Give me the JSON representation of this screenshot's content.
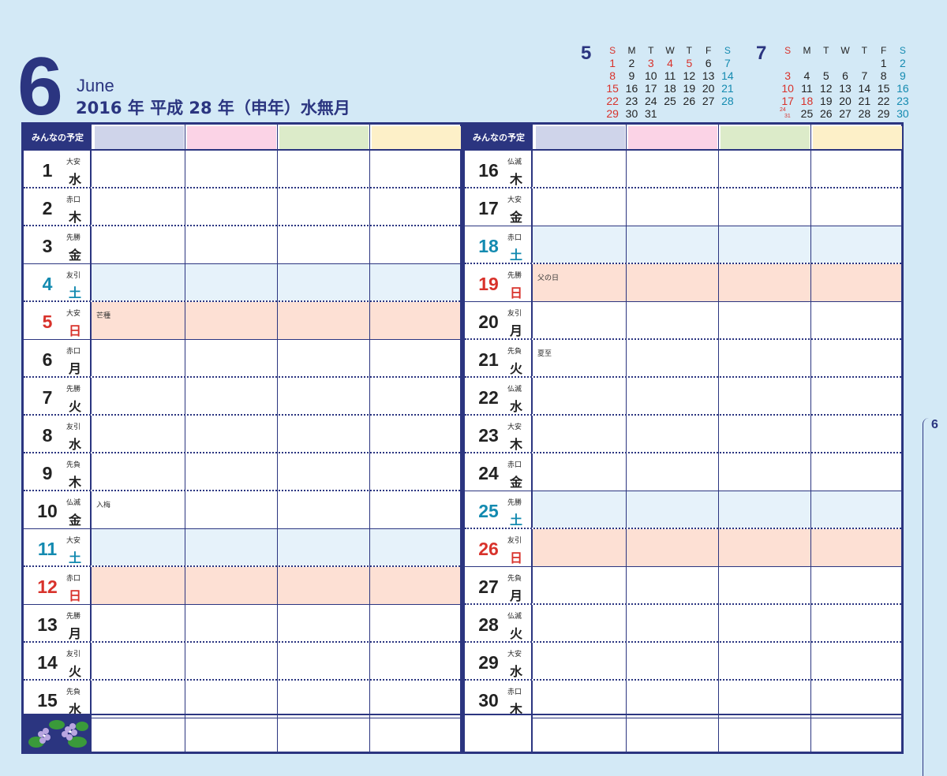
{
  "header": {
    "month_number": "6",
    "month_en": "June",
    "year_line": "2016 年  平成 28 年（申年）水無月"
  },
  "mini_calendars": [
    {
      "month": "5",
      "weekdays": [
        "S",
        "M",
        "T",
        "W",
        "T",
        "F",
        "S"
      ],
      "rows": [
        [
          "1",
          "2",
          "3",
          "4",
          "5",
          "6",
          "7"
        ],
        [
          "8",
          "9",
          "10",
          "11",
          "12",
          "13",
          "14"
        ],
        [
          "15",
          "16",
          "17",
          "18",
          "19",
          "20",
          "21"
        ],
        [
          "22",
          "23",
          "24",
          "25",
          "26",
          "27",
          "28"
        ],
        [
          "29",
          "30",
          "31",
          "",
          "",
          "",
          ""
        ]
      ],
      "red": [
        "1",
        "8",
        "15",
        "22",
        "29",
        "3",
        "4",
        "5"
      ]
    },
    {
      "month": "7",
      "weekdays": [
        "S",
        "M",
        "T",
        "W",
        "T",
        "F",
        "S"
      ],
      "rows": [
        [
          "",
          "",
          "",
          "",
          "",
          "1",
          "2"
        ],
        [
          "3",
          "4",
          "5",
          "6",
          "7",
          "8",
          "9"
        ],
        [
          "10",
          "11",
          "12",
          "13",
          "14",
          "15",
          "16"
        ],
        [
          "17",
          "18",
          "19",
          "20",
          "21",
          "22",
          "23"
        ],
        [
          "24/31",
          "25",
          "26",
          "27",
          "28",
          "29",
          "30"
        ]
      ],
      "red": [
        "3",
        "10",
        "17",
        "18",
        "24/31"
      ]
    }
  ],
  "tab_label": "6",
  "column_header": "みんなの予定",
  "column_colors": [
    "#cfd4ea",
    "#fbd3e6",
    "#dcebc9",
    "#fdf0c8"
  ],
  "colors": {
    "navy": "#2b3580",
    "sunday": "#d8322b",
    "saturday": "#138ab0",
    "sat_bg": "#e6f2fa",
    "sun_bg": "#fde0d4"
  },
  "left_days": [
    {
      "day": "1",
      "rokuyo": "大安",
      "wday": "水",
      "type": "weekday",
      "note": ""
    },
    {
      "day": "2",
      "rokuyo": "赤口",
      "wday": "木",
      "type": "weekday",
      "note": ""
    },
    {
      "day": "3",
      "rokuyo": "先勝",
      "wday": "金",
      "type": "weekday",
      "note": ""
    },
    {
      "day": "4",
      "rokuyo": "友引",
      "wday": "土",
      "type": "sat",
      "note": ""
    },
    {
      "day": "5",
      "rokuyo": "大安",
      "wday": "日",
      "type": "sun",
      "note": "芒種"
    },
    {
      "day": "6",
      "rokuyo": "赤口",
      "wday": "月",
      "type": "weekday",
      "note": ""
    },
    {
      "day": "7",
      "rokuyo": "先勝",
      "wday": "火",
      "type": "weekday",
      "note": ""
    },
    {
      "day": "8",
      "rokuyo": "友引",
      "wday": "水",
      "type": "weekday",
      "note": ""
    },
    {
      "day": "9",
      "rokuyo": "先負",
      "wday": "木",
      "type": "weekday",
      "note": ""
    },
    {
      "day": "10",
      "rokuyo": "仏滅",
      "wday": "金",
      "type": "weekday",
      "note": "入梅"
    },
    {
      "day": "11",
      "rokuyo": "大安",
      "wday": "土",
      "type": "sat",
      "note": ""
    },
    {
      "day": "12",
      "rokuyo": "赤口",
      "wday": "日",
      "type": "sun",
      "note": ""
    },
    {
      "day": "13",
      "rokuyo": "先勝",
      "wday": "月",
      "type": "weekday",
      "note": ""
    },
    {
      "day": "14",
      "rokuyo": "友引",
      "wday": "火",
      "type": "weekday",
      "note": ""
    },
    {
      "day": "15",
      "rokuyo": "先負",
      "wday": "水",
      "type": "weekday",
      "note": ""
    }
  ],
  "right_days": [
    {
      "day": "16",
      "rokuyo": "仏滅",
      "wday": "木",
      "type": "weekday",
      "note": ""
    },
    {
      "day": "17",
      "rokuyo": "大安",
      "wday": "金",
      "type": "weekday",
      "note": ""
    },
    {
      "day": "18",
      "rokuyo": "赤口",
      "wday": "土",
      "type": "sat",
      "note": ""
    },
    {
      "day": "19",
      "rokuyo": "先勝",
      "wday": "日",
      "type": "sun",
      "note": "父の日"
    },
    {
      "day": "20",
      "rokuyo": "友引",
      "wday": "月",
      "type": "weekday",
      "note": ""
    },
    {
      "day": "21",
      "rokuyo": "先負",
      "wday": "火",
      "type": "weekday",
      "note": "夏至"
    },
    {
      "day": "22",
      "rokuyo": "仏滅",
      "wday": "水",
      "type": "weekday",
      "note": ""
    },
    {
      "day": "23",
      "rokuyo": "大安",
      "wday": "木",
      "type": "weekday",
      "note": ""
    },
    {
      "day": "24",
      "rokuyo": "赤口",
      "wday": "金",
      "type": "weekday",
      "note": ""
    },
    {
      "day": "25",
      "rokuyo": "先勝",
      "wday": "土",
      "type": "sat",
      "note": ""
    },
    {
      "day": "26",
      "rokuyo": "友引",
      "wday": "日",
      "type": "sun",
      "note": ""
    },
    {
      "day": "27",
      "rokuyo": "先負",
      "wday": "月",
      "type": "weekday",
      "note": ""
    },
    {
      "day": "28",
      "rokuyo": "仏滅",
      "wday": "火",
      "type": "weekday",
      "note": ""
    },
    {
      "day": "29",
      "rokuyo": "大安",
      "wday": "水",
      "type": "weekday",
      "note": ""
    },
    {
      "day": "30",
      "rokuyo": "赤口",
      "wday": "木",
      "type": "weekday",
      "note": ""
    }
  ]
}
